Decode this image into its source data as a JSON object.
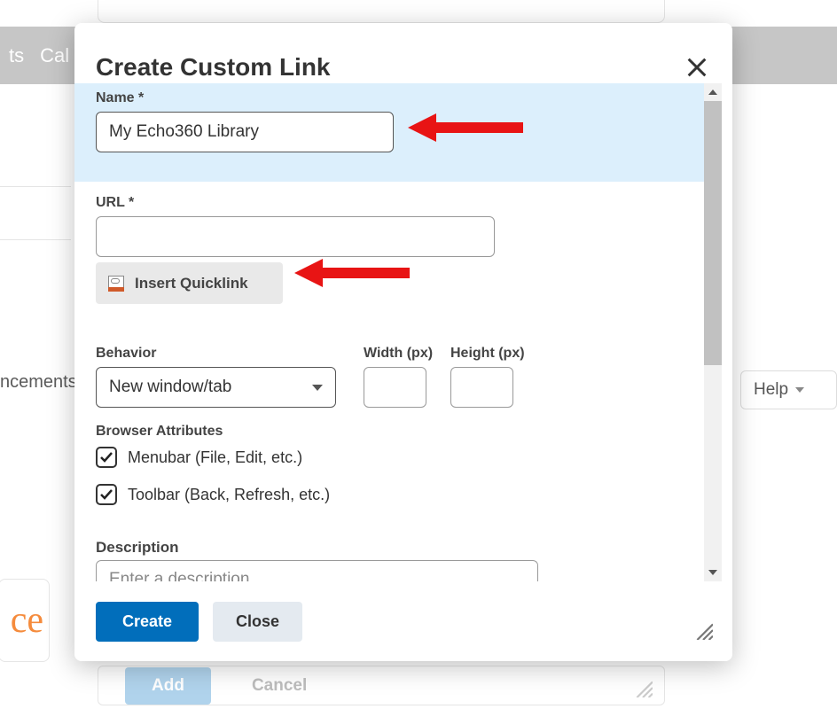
{
  "bg": {
    "topbar_items": [
      "ts",
      "Cal"
    ],
    "ncements_text": "ncements",
    "help_label": "Help",
    "ce_text": "ce",
    "add_label": "Add",
    "cancel_label": "Cancel"
  },
  "dialog": {
    "title": "Create Custom Link",
    "name_label": "Name *",
    "name_value": "My Echo360 Library",
    "url_label": "URL *",
    "url_value": "",
    "quicklink_label": "Insert Quicklink",
    "behavior_label": "Behavior",
    "behavior_value": "New window/tab",
    "width_label": "Width (px)",
    "width_value": "",
    "height_label": "Height (px)",
    "height_value": "",
    "browser_attr_label": "Browser Attributes",
    "menubar_label": "Menubar (File, Edit, etc.)",
    "toolbar_label": "Toolbar (Back, Refresh, etc.)",
    "description_label": "Description",
    "description_placeholder": "Enter a description",
    "create_label": "Create",
    "close_label": "Close"
  }
}
